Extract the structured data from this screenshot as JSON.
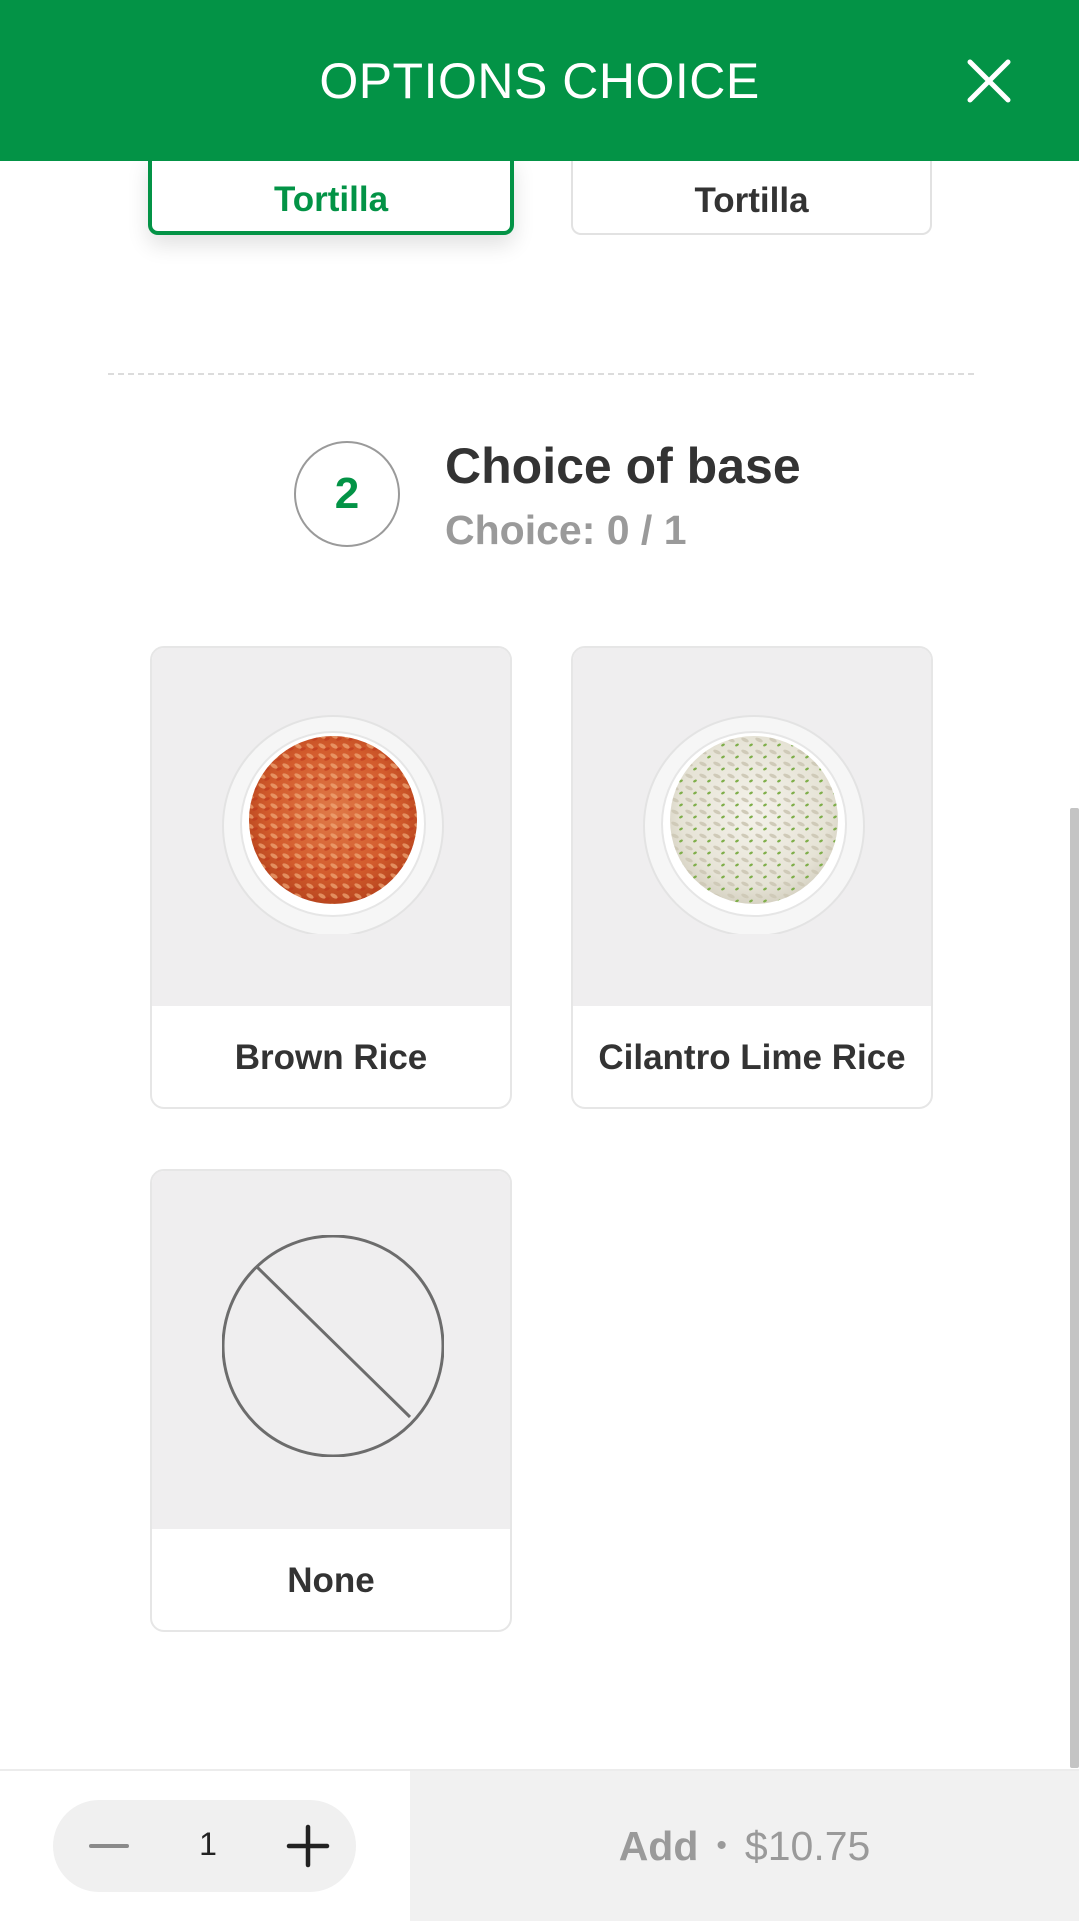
{
  "header": {
    "title": "OPTIONS CHOICE",
    "close_icon": "close-icon"
  },
  "previous_section": {
    "options": [
      {
        "label": "Tortilla",
        "selected": true
      },
      {
        "label": "Tortilla",
        "selected": false
      }
    ]
  },
  "section": {
    "step_number": "2",
    "title": "Choice of base",
    "choice_counter": "Choice: 0 / 1",
    "options": [
      {
        "label": "Brown Rice",
        "image": "brown-rice-bowl"
      },
      {
        "label": "Cilantro Lime Rice",
        "image": "cilantro-lime-rice-bowl"
      },
      {
        "label": "None",
        "image": "none-icon"
      }
    ]
  },
  "footer": {
    "quantity": "1",
    "add_label": "Add",
    "separator": "•",
    "price": "$10.75"
  },
  "colors": {
    "brand": "#039346",
    "muted": "#9a9a9a"
  }
}
